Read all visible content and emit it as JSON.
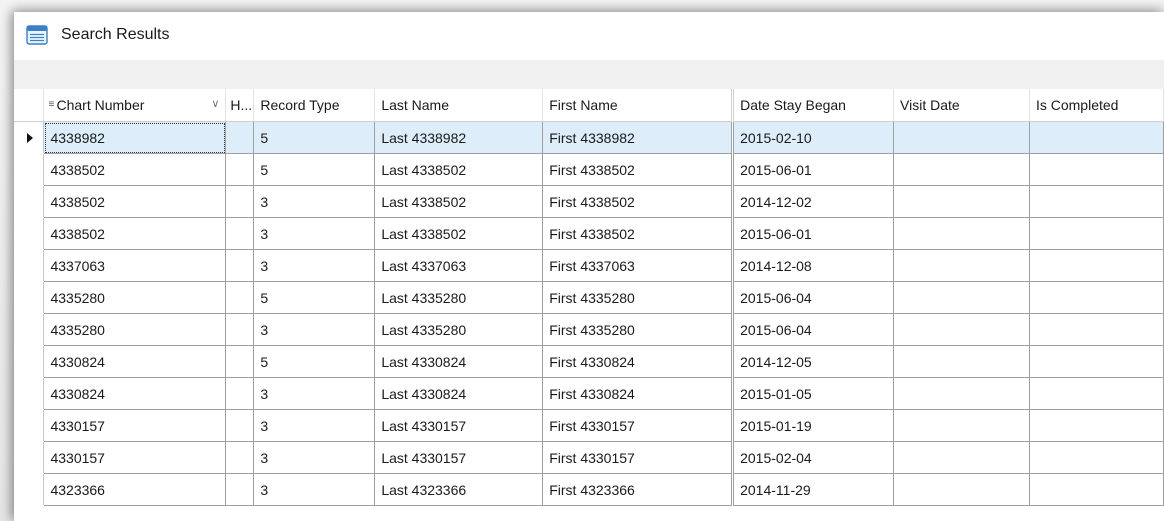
{
  "window": {
    "title": "Search Results"
  },
  "grid": {
    "columns": [
      {
        "key": "chart_number",
        "label": "Chart Number"
      },
      {
        "key": "h",
        "label": "H..."
      },
      {
        "key": "record_type",
        "label": "Record Type"
      },
      {
        "key": "last_name",
        "label": "Last Name"
      },
      {
        "key": "first_name",
        "label": "First Name"
      },
      {
        "key": "date_stay_began",
        "label": "Date Stay Began"
      },
      {
        "key": "visit_date",
        "label": "Visit Date"
      },
      {
        "key": "is_completed",
        "label": "Is Completed"
      }
    ],
    "rows": [
      {
        "chart_number": "4338982",
        "h": "",
        "record_type": "5",
        "last_name": "Last 4338982",
        "first_name": "First 4338982",
        "date_stay_began": "2015-02-10",
        "visit_date": "",
        "is_completed": ""
      },
      {
        "chart_number": "4338502",
        "h": "",
        "record_type": "5",
        "last_name": "Last 4338502",
        "first_name": "First 4338502",
        "date_stay_began": "2015-06-01",
        "visit_date": "",
        "is_completed": ""
      },
      {
        "chart_number": "4338502",
        "h": "",
        "record_type": "3",
        "last_name": "Last 4338502",
        "first_name": "First 4338502",
        "date_stay_began": "2014-12-02",
        "visit_date": "",
        "is_completed": ""
      },
      {
        "chart_number": "4338502",
        "h": "",
        "record_type": "3",
        "last_name": "Last 4338502",
        "first_name": "First 4338502",
        "date_stay_began": "2015-06-01",
        "visit_date": "",
        "is_completed": ""
      },
      {
        "chart_number": "4337063",
        "h": "",
        "record_type": "3",
        "last_name": "Last 4337063",
        "first_name": "First 4337063",
        "date_stay_began": "2014-12-08",
        "visit_date": "",
        "is_completed": ""
      },
      {
        "chart_number": "4335280",
        "h": "",
        "record_type": "5",
        "last_name": "Last 4335280",
        "first_name": "First 4335280",
        "date_stay_began": "2015-06-04",
        "visit_date": "",
        "is_completed": ""
      },
      {
        "chart_number": "4335280",
        "h": "",
        "record_type": "3",
        "last_name": "Last 4335280",
        "first_name": "First 4335280",
        "date_stay_began": "2015-06-04",
        "visit_date": "",
        "is_completed": ""
      },
      {
        "chart_number": "4330824",
        "h": "",
        "record_type": "5",
        "last_name": "Last 4330824",
        "first_name": "First 4330824",
        "date_stay_began": "2014-12-05",
        "visit_date": "",
        "is_completed": ""
      },
      {
        "chart_number": "4330824",
        "h": "",
        "record_type": "3",
        "last_name": "Last 4330824",
        "first_name": "First 4330824",
        "date_stay_began": "2015-01-05",
        "visit_date": "",
        "is_completed": ""
      },
      {
        "chart_number": "4330157",
        "h": "",
        "record_type": "3",
        "last_name": "Last 4330157",
        "first_name": "First 4330157",
        "date_stay_began": "2015-01-19",
        "visit_date": "",
        "is_completed": ""
      },
      {
        "chart_number": "4330157",
        "h": "",
        "record_type": "3",
        "last_name": "Last 4330157",
        "first_name": "First 4330157",
        "date_stay_began": "2015-02-04",
        "visit_date": "",
        "is_completed": ""
      },
      {
        "chart_number": "4323366",
        "h": "",
        "record_type": "3",
        "last_name": "Last 4323366",
        "first_name": "First 4323366",
        "date_stay_began": "2014-11-29",
        "visit_date": "",
        "is_completed": ""
      }
    ],
    "selected_row_index": 0
  },
  "icons": {
    "window": "grid-window-icon",
    "column_chooser": "column-chooser-icon",
    "sort": "chevron-down-icon",
    "current_row": "current-row-arrow-icon"
  }
}
